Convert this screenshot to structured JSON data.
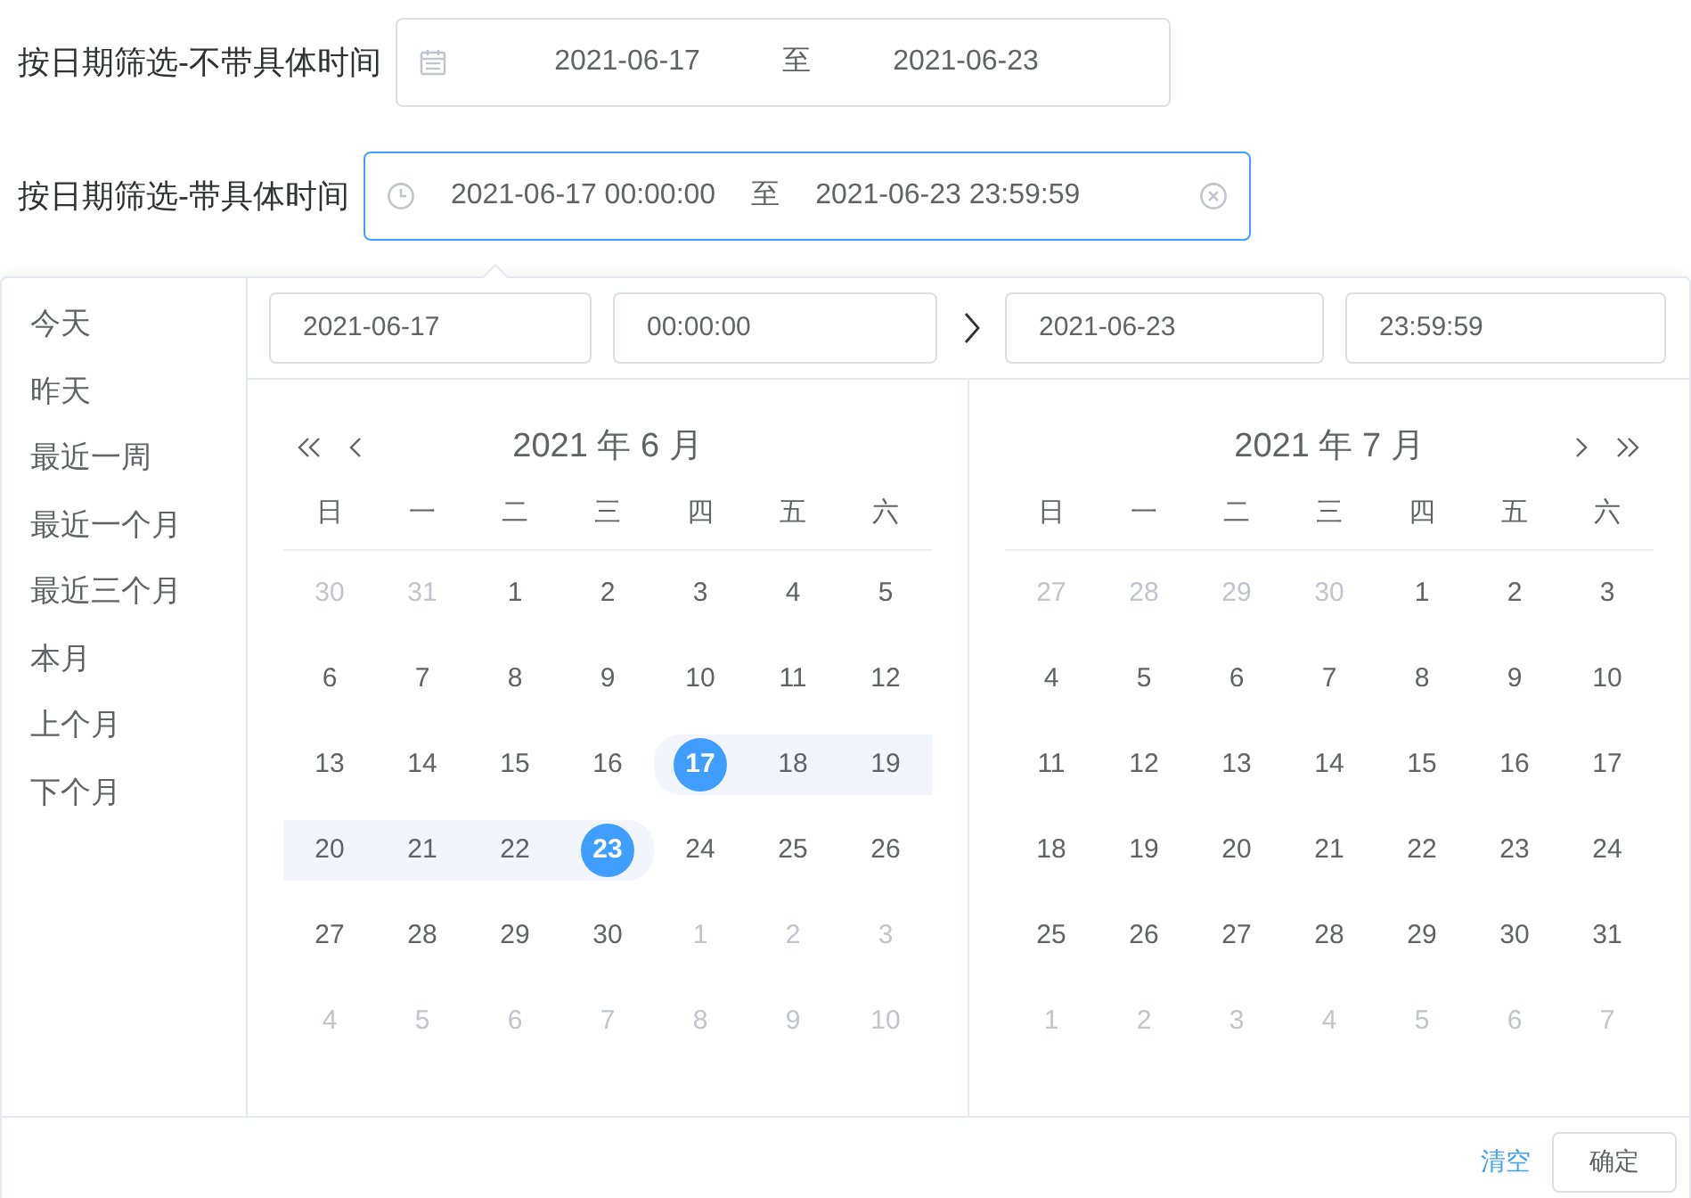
{
  "filters": [
    {
      "label": "按日期筛选-不带具体时间",
      "kind": "date",
      "start": "2021-06-17",
      "separator": "至",
      "end": "2021-06-23",
      "focused": false
    },
    {
      "label": "按日期筛选-带具体时间",
      "kind": "datetime",
      "start": "2021-06-17 00:00:00",
      "separator": "至",
      "end": "2021-06-23 23:59:59",
      "focused": true
    }
  ],
  "picker": {
    "shortcuts": [
      "今天",
      "昨天",
      "最近一周",
      "最近一个月",
      "最近三个月",
      "本月",
      "上个月",
      "下个月"
    ],
    "range_inputs": {
      "start_date": "2021-06-17",
      "start_time": "00:00:00",
      "end_date": "2021-06-23",
      "end_time": "23:59:59"
    },
    "panels": [
      {
        "kind": "left",
        "title": "2021 年 6 月",
        "weekdays": [
          "日",
          "一",
          "二",
          "三",
          "四",
          "五",
          "六"
        ],
        "weeks": [
          [
            {
              "text": "30",
              "muted": true,
              "in_range": false,
              "selected": false
            },
            {
              "text": "31",
              "muted": true,
              "in_range": false,
              "selected": false
            },
            {
              "text": "1",
              "muted": false,
              "in_range": false,
              "selected": false
            },
            {
              "text": "2",
              "muted": false,
              "in_range": false,
              "selected": false
            },
            {
              "text": "3",
              "muted": false,
              "in_range": false,
              "selected": false
            },
            {
              "text": "4",
              "muted": false,
              "in_range": false,
              "selected": false
            },
            {
              "text": "5",
              "muted": false,
              "in_range": false,
              "selected": false
            }
          ],
          [
            {
              "text": "6",
              "muted": false,
              "in_range": false,
              "selected": false
            },
            {
              "text": "7",
              "muted": false,
              "in_range": false,
              "selected": false
            },
            {
              "text": "8",
              "muted": false,
              "in_range": false,
              "selected": false
            },
            {
              "text": "9",
              "muted": false,
              "in_range": false,
              "selected": false
            },
            {
              "text": "10",
              "muted": false,
              "in_range": false,
              "selected": false
            },
            {
              "text": "11",
              "muted": false,
              "in_range": false,
              "selected": false
            },
            {
              "text": "12",
              "muted": false,
              "in_range": false,
              "selected": false
            }
          ],
          [
            {
              "text": "13",
              "muted": false,
              "in_range": false,
              "selected": false
            },
            {
              "text": "14",
              "muted": false,
              "in_range": false,
              "selected": false
            },
            {
              "text": "15",
              "muted": false,
              "in_range": false,
              "selected": false
            },
            {
              "text": "16",
              "muted": false,
              "in_range": false,
              "selected": false
            },
            {
              "text": "17",
              "muted": false,
              "in_range": true,
              "selected": true
            },
            {
              "text": "18",
              "muted": false,
              "in_range": true,
              "selected": false
            },
            {
              "text": "19",
              "muted": false,
              "in_range": true,
              "selected": false
            }
          ],
          [
            {
              "text": "20",
              "muted": false,
              "in_range": true,
              "selected": false
            },
            {
              "text": "21",
              "muted": false,
              "in_range": true,
              "selected": false
            },
            {
              "text": "22",
              "muted": false,
              "in_range": true,
              "selected": false
            },
            {
              "text": "23",
              "muted": false,
              "in_range": true,
              "selected": true
            },
            {
              "text": "24",
              "muted": false,
              "in_range": false,
              "selected": false
            },
            {
              "text": "25",
              "muted": false,
              "in_range": false,
              "selected": false
            },
            {
              "text": "26",
              "muted": false,
              "in_range": false,
              "selected": false
            }
          ],
          [
            {
              "text": "27",
              "muted": false,
              "in_range": false,
              "selected": false
            },
            {
              "text": "28",
              "muted": false,
              "in_range": false,
              "selected": false
            },
            {
              "text": "29",
              "muted": false,
              "in_range": false,
              "selected": false
            },
            {
              "text": "30",
              "muted": false,
              "in_range": false,
              "selected": false
            },
            {
              "text": "1",
              "muted": true,
              "in_range": false,
              "selected": false
            },
            {
              "text": "2",
              "muted": true,
              "in_range": false,
              "selected": false
            },
            {
              "text": "3",
              "muted": true,
              "in_range": false,
              "selected": false
            }
          ],
          [
            {
              "text": "4",
              "muted": true,
              "in_range": false,
              "selected": false
            },
            {
              "text": "5",
              "muted": true,
              "in_range": false,
              "selected": false
            },
            {
              "text": "6",
              "muted": true,
              "in_range": false,
              "selected": false
            },
            {
              "text": "7",
              "muted": true,
              "in_range": false,
              "selected": false
            },
            {
              "text": "8",
              "muted": true,
              "in_range": false,
              "selected": false
            },
            {
              "text": "9",
              "muted": true,
              "in_range": false,
              "selected": false
            },
            {
              "text": "10",
              "muted": true,
              "in_range": false,
              "selected": false
            }
          ]
        ]
      },
      {
        "kind": "right",
        "title": "2021 年 7 月",
        "weekdays": [
          "日",
          "一",
          "二",
          "三",
          "四",
          "五",
          "六"
        ],
        "weeks": [
          [
            {
              "text": "27",
              "muted": true,
              "in_range": false,
              "selected": false
            },
            {
              "text": "28",
              "muted": true,
              "in_range": false,
              "selected": false
            },
            {
              "text": "29",
              "muted": true,
              "in_range": false,
              "selected": false
            },
            {
              "text": "30",
              "muted": true,
              "in_range": false,
              "selected": false
            },
            {
              "text": "1",
              "muted": false,
              "in_range": false,
              "selected": false
            },
            {
              "text": "2",
              "muted": false,
              "in_range": false,
              "selected": false
            },
            {
              "text": "3",
              "muted": false,
              "in_range": false,
              "selected": false
            }
          ],
          [
            {
              "text": "4",
              "muted": false,
              "in_range": false,
              "selected": false
            },
            {
              "text": "5",
              "muted": false,
              "in_range": false,
              "selected": false
            },
            {
              "text": "6",
              "muted": false,
              "in_range": false,
              "selected": false
            },
            {
              "text": "7",
              "muted": false,
              "in_range": false,
              "selected": false
            },
            {
              "text": "8",
              "muted": false,
              "in_range": false,
              "selected": false
            },
            {
              "text": "9",
              "muted": false,
              "in_range": false,
              "selected": false
            },
            {
              "text": "10",
              "muted": false,
              "in_range": false,
              "selected": false
            }
          ],
          [
            {
              "text": "11",
              "muted": false,
              "in_range": false,
              "selected": false
            },
            {
              "text": "12",
              "muted": false,
              "in_range": false,
              "selected": false
            },
            {
              "text": "13",
              "muted": false,
              "in_range": false,
              "selected": false
            },
            {
              "text": "14",
              "muted": false,
              "in_range": false,
              "selected": false
            },
            {
              "text": "15",
              "muted": false,
              "in_range": false,
              "selected": false
            },
            {
              "text": "16",
              "muted": false,
              "in_range": false,
              "selected": false
            },
            {
              "text": "17",
              "muted": false,
              "in_range": false,
              "selected": false
            }
          ],
          [
            {
              "text": "18",
              "muted": false,
              "in_range": false,
              "selected": false
            },
            {
              "text": "19",
              "muted": false,
              "in_range": false,
              "selected": false
            },
            {
              "text": "20",
              "muted": false,
              "in_range": false,
              "selected": false
            },
            {
              "text": "21",
              "muted": false,
              "in_range": false,
              "selected": false
            },
            {
              "text": "22",
              "muted": false,
              "in_range": false,
              "selected": false
            },
            {
              "text": "23",
              "muted": false,
              "in_range": false,
              "selected": false
            },
            {
              "text": "24",
              "muted": false,
              "in_range": false,
              "selected": false
            }
          ],
          [
            {
              "text": "25",
              "muted": false,
              "in_range": false,
              "selected": false
            },
            {
              "text": "26",
              "muted": false,
              "in_range": false,
              "selected": false
            },
            {
              "text": "27",
              "muted": false,
              "in_range": false,
              "selected": false
            },
            {
              "text": "28",
              "muted": false,
              "in_range": false,
              "selected": false
            },
            {
              "text": "29",
              "muted": false,
              "in_range": false,
              "selected": false
            },
            {
              "text": "30",
              "muted": false,
              "in_range": false,
              "selected": false
            },
            {
              "text": "31",
              "muted": false,
              "in_range": false,
              "selected": false
            }
          ],
          [
            {
              "text": "1",
              "muted": true,
              "in_range": false,
              "selected": false
            },
            {
              "text": "2",
              "muted": true,
              "in_range": false,
              "selected": false
            },
            {
              "text": "3",
              "muted": true,
              "in_range": false,
              "selected": false
            },
            {
              "text": "4",
              "muted": true,
              "in_range": false,
              "selected": false
            },
            {
              "text": "5",
              "muted": true,
              "in_range": false,
              "selected": false
            },
            {
              "text": "6",
              "muted": true,
              "in_range": false,
              "selected": false
            },
            {
              "text": "7",
              "muted": true,
              "in_range": false,
              "selected": false
            }
          ]
        ]
      }
    ],
    "footer": {
      "clear": "清空",
      "confirm": "确定"
    }
  }
}
